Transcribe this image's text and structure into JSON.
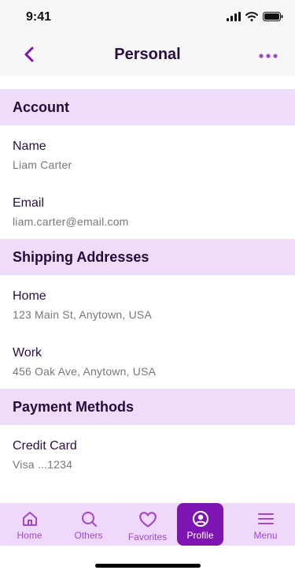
{
  "status": {
    "time": "9:41",
    "icons": [
      "signal-icon",
      "wifi-icon",
      "battery-icon"
    ]
  },
  "nav": {
    "title": "Personal",
    "back_icon": "chevron-left-icon",
    "more_icon": "more-dots-icon"
  },
  "sections": {
    "account": {
      "title": "Account",
      "items": [
        {
          "label": "Name",
          "value": "Liam Carter"
        },
        {
          "label": "Email",
          "value": "liam.carter@email.com"
        }
      ]
    },
    "shipping": {
      "title": "Shipping Addresses",
      "items": [
        {
          "label": "Home",
          "value": "123 Main St, Anytown, USA"
        },
        {
          "label": "Work",
          "value": "456 Oak Ave, Anytown, USA"
        }
      ]
    },
    "payment": {
      "title": "Payment Methods",
      "items": [
        {
          "label": "Credit Card",
          "value": "Visa ...1234"
        }
      ]
    }
  },
  "tabs": [
    {
      "label": "Home",
      "icon": "home-icon"
    },
    {
      "label": "Others",
      "icon": "search-icon"
    },
    {
      "label": "Favorites",
      "icon": "heart-icon"
    },
    {
      "label": "Profile",
      "icon": "profile-icon",
      "active": true
    },
    {
      "label": "Menu",
      "icon": "menu-icon"
    }
  ],
  "colors": {
    "accent": "#7e14b1",
    "tab_inactive": "#a347cf",
    "section_bg": "#efdcfb",
    "tabbar_bg": "#eed8fb",
    "title_text": "#2a0f3f"
  }
}
